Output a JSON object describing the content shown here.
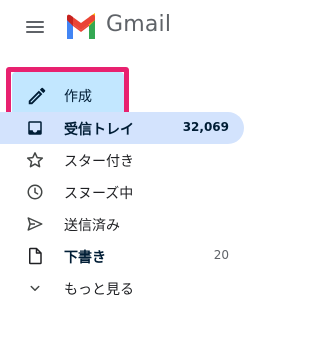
{
  "app": {
    "brand": "Gmail"
  },
  "compose": {
    "label": "作成"
  },
  "sidebar": {
    "items": [
      {
        "label": "受信トレイ",
        "count": "32,069",
        "icon": "inbox-icon"
      },
      {
        "label": "スター付き",
        "count": "",
        "icon": "star-icon"
      },
      {
        "label": "スヌーズ中",
        "count": "",
        "icon": "clock-icon"
      },
      {
        "label": "送信済み",
        "count": "",
        "icon": "send-icon"
      },
      {
        "label": "下書き",
        "count": "20",
        "icon": "draft-icon"
      },
      {
        "label": "もっと見る",
        "count": "",
        "icon": "chevron-down-icon"
      }
    ]
  },
  "colors": {
    "compose_bg": "#c2e7ff",
    "active_bg": "#d3e3fd",
    "highlight_border": "#e8216f"
  }
}
